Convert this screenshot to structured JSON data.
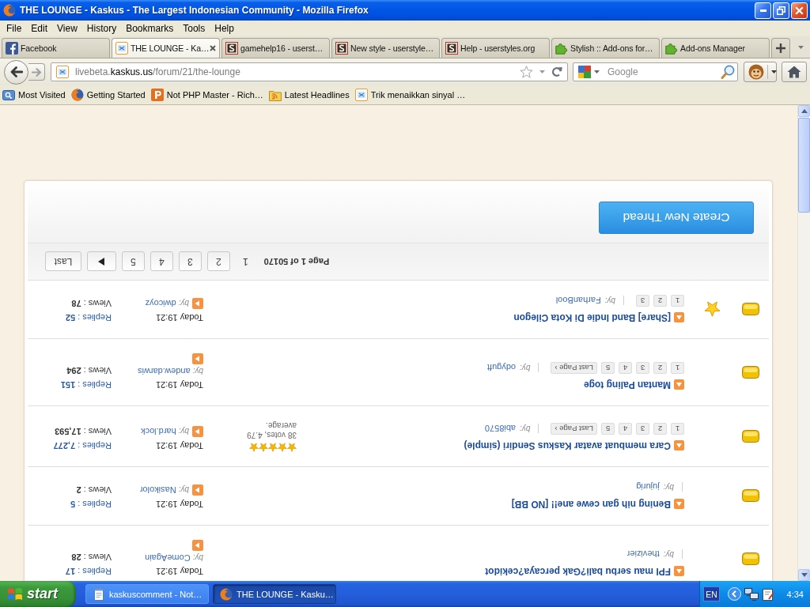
{
  "window": {
    "title": "THE LOUNGE - Kaskus - The Largest Indonesian Community - Mozilla Firefox"
  },
  "menu": [
    "File",
    "Edit",
    "View",
    "History",
    "Bookmarks",
    "Tools",
    "Help"
  ],
  "tabs": [
    {
      "label": "Facebook",
      "kind": "facebook",
      "selected": false
    },
    {
      "label": "THE LOUNGE - Ka…",
      "kind": "kaskus",
      "selected": true
    },
    {
      "label": "gamehelp16 - userst…",
      "kind": "userstyles",
      "selected": false
    },
    {
      "label": "New style - userstyle…",
      "kind": "userstyles",
      "selected": false
    },
    {
      "label": "Help - userstyles.org",
      "kind": "userstyles",
      "selected": false
    },
    {
      "label": "Stylish :: Add-ons for…",
      "kind": "addon",
      "selected": false
    },
    {
      "label": "Add-ons Manager",
      "kind": "addon",
      "selected": false
    }
  ],
  "toolbar": {
    "url": "livebeta.**kaskus.us**/forum/21/the-lounge",
    "search": {
      "placeholder": "Google"
    }
  },
  "bookmarks": [
    {
      "label": "Most Visited",
      "kind": "folder"
    },
    {
      "label": "Getting Started",
      "kind": "firefox"
    },
    {
      "label": "Not PHP Master - Rich…",
      "kind": "letter"
    },
    {
      "label": "Latest Headlines",
      "kind": "feed"
    },
    {
      "label": "Trik menaikkan sinyal …",
      "kind": "kaskus"
    }
  ],
  "thread_list": {
    "create_button": "Create New Thread",
    "pagination": {
      "label": "Page 1 of 50170",
      "pages": [
        {
          "label": "1",
          "selected": true
        },
        {
          "label": "2",
          "selected": false
        },
        {
          "label": "3",
          "selected": false
        },
        {
          "label": "4",
          "selected": false
        },
        {
          "label": "5",
          "selected": false
        }
      ],
      "last": "Last"
    },
    "threads": [
      {
        "title": "[Share] Band Indie Di Kota Cilegon",
        "featured": true,
        "pages": [
          "1",
          "2",
          "3"
        ],
        "starter": {
          "by": "by:",
          "name": "FarhanBool"
        },
        "last_post": {
          "date": "Today 19:21",
          "by": "by:",
          "name": "dwicoyz"
        },
        "stats": {
          "replies": "Replies : **52**",
          "views": "Views : **78**"
        }
      },
      {
        "title": "Mantan Paling toge",
        "featured": false,
        "pages": [
          "1",
          "2",
          "3",
          "4",
          "5"
        ],
        "last_page": "Last Page ›",
        "starter": {
          "by": "by:",
          "name": "odyguft"
        },
        "last_post": {
          "date": "Today 19:21",
          "by": "by:",
          "name": "andew.darwis"
        },
        "stats": {
          "replies": "Replies : **151**",
          "views": "Views : **294**"
        }
      },
      {
        "title": "Cara membuat avatar Kaskus Sendiri (simple)",
        "featured": false,
        "pages": [
          "1",
          "2",
          "3",
          "4",
          "5"
        ],
        "last_page": "Last Page ›",
        "starter": {
          "by": "by:",
          "name": "abi8570"
        },
        "rating": {
          "stars": 5,
          "votes": "38 votes, 4.79 average."
        },
        "last_post": {
          "date": "Today 19:21",
          "by": "by:",
          "name": "hard.lock"
        },
        "stats": {
          "replies": "Replies : **7,277**",
          "views": "Views : **17,593**"
        }
      },
      {
        "title": "Bening nih gan cewe ane!! [NO BB]",
        "featured": false,
        "starter": {
          "by": "by:",
          "name": "jujurig"
        },
        "last_post": {
          "date": "Today 19:21",
          "by": "by:",
          "name": "Nasikolor"
        },
        "stats": {
          "replies": "Replies : **5**",
          "views": "Views : **2**"
        }
      },
      {
        "title": "FPI mau serbu bali?Gak percaya?cekidot",
        "featured": false,
        "starter": {
          "by": "by:",
          "name": "thevizier"
        },
        "last_post": {
          "date": "Today 19:21",
          "by": "by:",
          "name": "ComeAgain"
        },
        "stats": {
          "replies": "Replies : **17**",
          "views": "Views : **28**"
        }
      }
    ]
  },
  "taskbar": {
    "start": "start",
    "tasks": [
      {
        "label": "kaskuscomment - Not…",
        "kind": "notepad",
        "selected": false
      },
      {
        "label": "THE LOUNGE - Kasku…",
        "kind": "browser",
        "selected": true
      }
    ],
    "language": "EN",
    "clock": "4:34"
  }
}
